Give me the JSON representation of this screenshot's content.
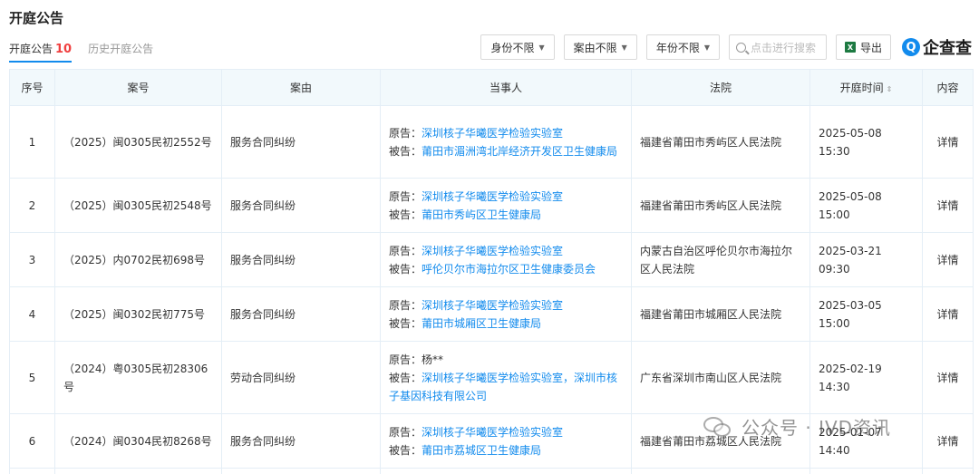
{
  "page": {
    "title": "开庭公告"
  },
  "tabs": [
    {
      "label": "开庭公告",
      "count": "10"
    },
    {
      "label": "历史开庭公告"
    }
  ],
  "toolbar": {
    "filters": [
      "身份不限",
      "案由不限",
      "年份不限"
    ],
    "search_placeholder": "点击进行搜索",
    "export_label": "导出",
    "excel_glyph": "X",
    "brand_glyph": "Q",
    "brand_name": "企查查"
  },
  "table": {
    "headers": [
      "序号",
      "案号",
      "案由",
      "当事人",
      "法院",
      "开庭时间",
      "内容"
    ],
    "plaintiff_label": "原告：",
    "defendant_label": "被告：",
    "rows": [
      {
        "index": "1",
        "case_no": "（2025）闽0305民初2552号",
        "cause": "服务合同纠纷",
        "plaintiff": "深圳核子华曦医学检验实验室",
        "defendant": "莆田市湄洲湾北岸经济开发区卫生健康局",
        "court": "福建省莆田市秀屿区人民法院",
        "time": "2025-05-08 15:30",
        "detail": "详情"
      },
      {
        "index": "2",
        "case_no": "（2025）闽0305民初2548号",
        "cause": "服务合同纠纷",
        "plaintiff": "深圳核子华曦医学检验实验室",
        "defendant": "莆田市秀屿区卫生健康局",
        "court": "福建省莆田市秀屿区人民法院",
        "time": "2025-05-08 15:00",
        "detail": "详情"
      },
      {
        "index": "3",
        "case_no": "（2025）内0702民初698号",
        "cause": "服务合同纠纷",
        "plaintiff": "深圳核子华曦医学检验实验室",
        "defendant": "呼伦贝尔市海拉尔区卫生健康委员会",
        "court": "内蒙古自治区呼伦贝尔市海拉尔区人民法院",
        "time": "2025-03-21 09:30",
        "detail": "详情"
      },
      {
        "index": "4",
        "case_no": "（2025）闽0302民初775号",
        "cause": "服务合同纠纷",
        "plaintiff": "深圳核子华曦医学检验实验室",
        "defendant": "莆田市城厢区卫生健康局",
        "court": "福建省莆田市城厢区人民法院",
        "time": "2025-03-05 15:00",
        "detail": "详情"
      },
      {
        "index": "5",
        "case_no": "（2024）粤0305民初28306号",
        "cause": "劳动合同纠纷",
        "plaintiff": "杨**",
        "defendant": "深圳核子华曦医学检验实验室，深圳市核子基因科技有限公司",
        "court": "广东省深圳市南山区人民法院",
        "time": "2025-02-19 14:30",
        "detail": "详情"
      },
      {
        "index": "6",
        "case_no": "（2024）闽0304民初8268号",
        "cause": "服务合同纠纷",
        "plaintiff": "深圳核子华曦医学检验实验室",
        "defendant": "莆田市荔城区卫生健康局",
        "court": "福建省莆田市荔城区人民法院",
        "time": "2025-01-07 14:40",
        "detail": "详情"
      }
    ]
  },
  "watermark": {
    "text": "公众号 · IVD资讯"
  },
  "colors": {
    "accent": "#128bed",
    "count": "#f04040",
    "header_bg": "#f2f9fc",
    "border": "#e4eef6"
  }
}
